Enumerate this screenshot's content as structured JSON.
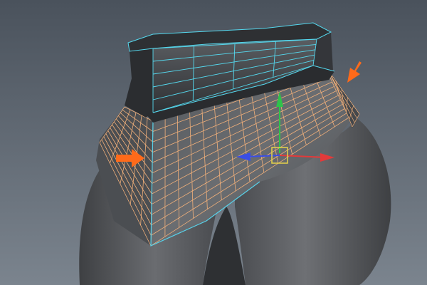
{
  "viewport": {
    "background_top": "#4a525c",
    "background_bottom": "#7b848e"
  },
  "mesh": {
    "body_color": "#5b5d60",
    "body_shadow": "#3c3e41",
    "belt_color": "#3a3c3f",
    "belt_highlight": "#6b6e72",
    "belt_wire_color": "#55d8ee",
    "skirt_fill": "#5c5f63",
    "skirt_wire_color": "#f2b07a",
    "skirt_border_color": "#58d2ea"
  },
  "manipulator": {
    "axis_x_color": "#e23a3a",
    "axis_y_color": "#2fc24a",
    "axis_z_color": "#3a4ee6",
    "pivot_color": "#e6d34a"
  },
  "annotations": {
    "arrow_color": "#ff6a1a",
    "arrows": [
      {
        "name": "left-arrow",
        "direction": "right"
      },
      {
        "name": "right-arrow",
        "direction": "down-left"
      }
    ]
  }
}
